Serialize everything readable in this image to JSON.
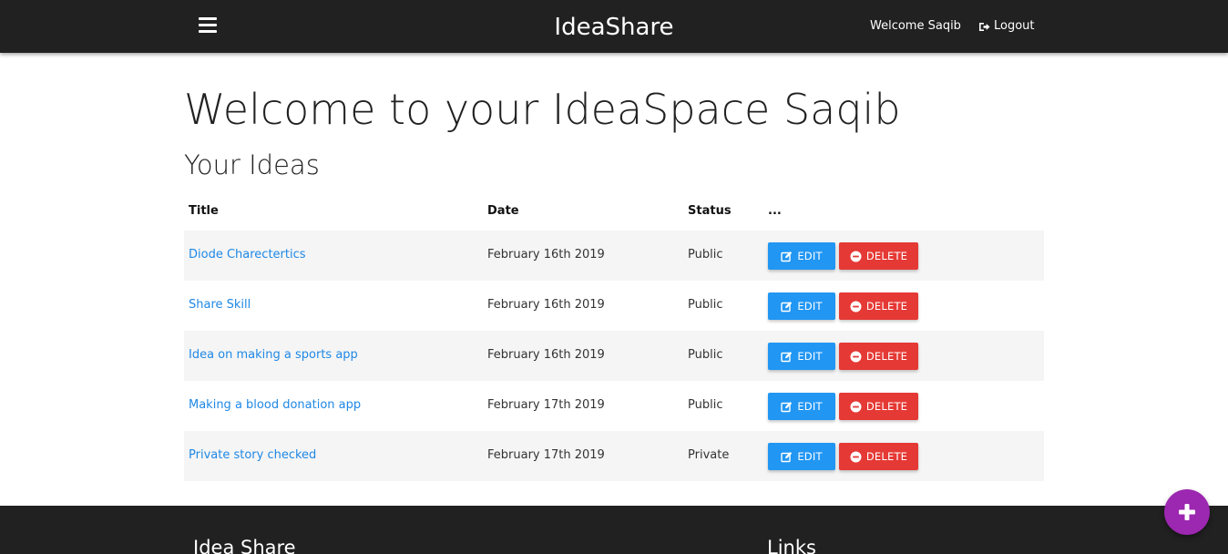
{
  "navbar": {
    "brand": "IdeaShare",
    "welcome": "Welcome Saqib",
    "logout": "Logout",
    "menu_icon": "hamburger-icon",
    "logout_icon": "sign-out-icon"
  },
  "main": {
    "heading": "Welcome to your IdeaSpace Saqib",
    "subheading": "Your Ideas"
  },
  "table": {
    "headers": [
      "Title",
      "Date",
      "Status",
      "..."
    ],
    "rows": [
      {
        "title": "Diode Charectertics",
        "date": "February 16th 2019",
        "status": "Public",
        "edit": "EDIT",
        "delete": "DELETE"
      },
      {
        "title": "Share Skill",
        "date": "February 16th 2019",
        "status": "Public",
        "edit": "EDIT",
        "delete": "DELETE"
      },
      {
        "title": "Idea on making a sports app",
        "date": "February 16th 2019",
        "status": "Public",
        "edit": "EDIT",
        "delete": "DELETE"
      },
      {
        "title": "Making a blood donation app",
        "date": "February 17th 2019",
        "status": "Public",
        "edit": "EDIT",
        "delete": "DELETE"
      },
      {
        "title": "Private story checked",
        "date": "February 17th 2019",
        "status": "Private",
        "edit": "EDIT",
        "delete": "DELETE"
      }
    ]
  },
  "footer": {
    "title": "Idea Share",
    "links_heading": "Links"
  },
  "fab": {
    "icon": "plus-icon"
  },
  "colors": {
    "navbar_bg": "#212121",
    "link": "#1e88e5",
    "edit_button": "#2196f3",
    "delete_button": "#e53935",
    "fab": "#9c27b0",
    "row_stripe": "#f5f5f5"
  }
}
